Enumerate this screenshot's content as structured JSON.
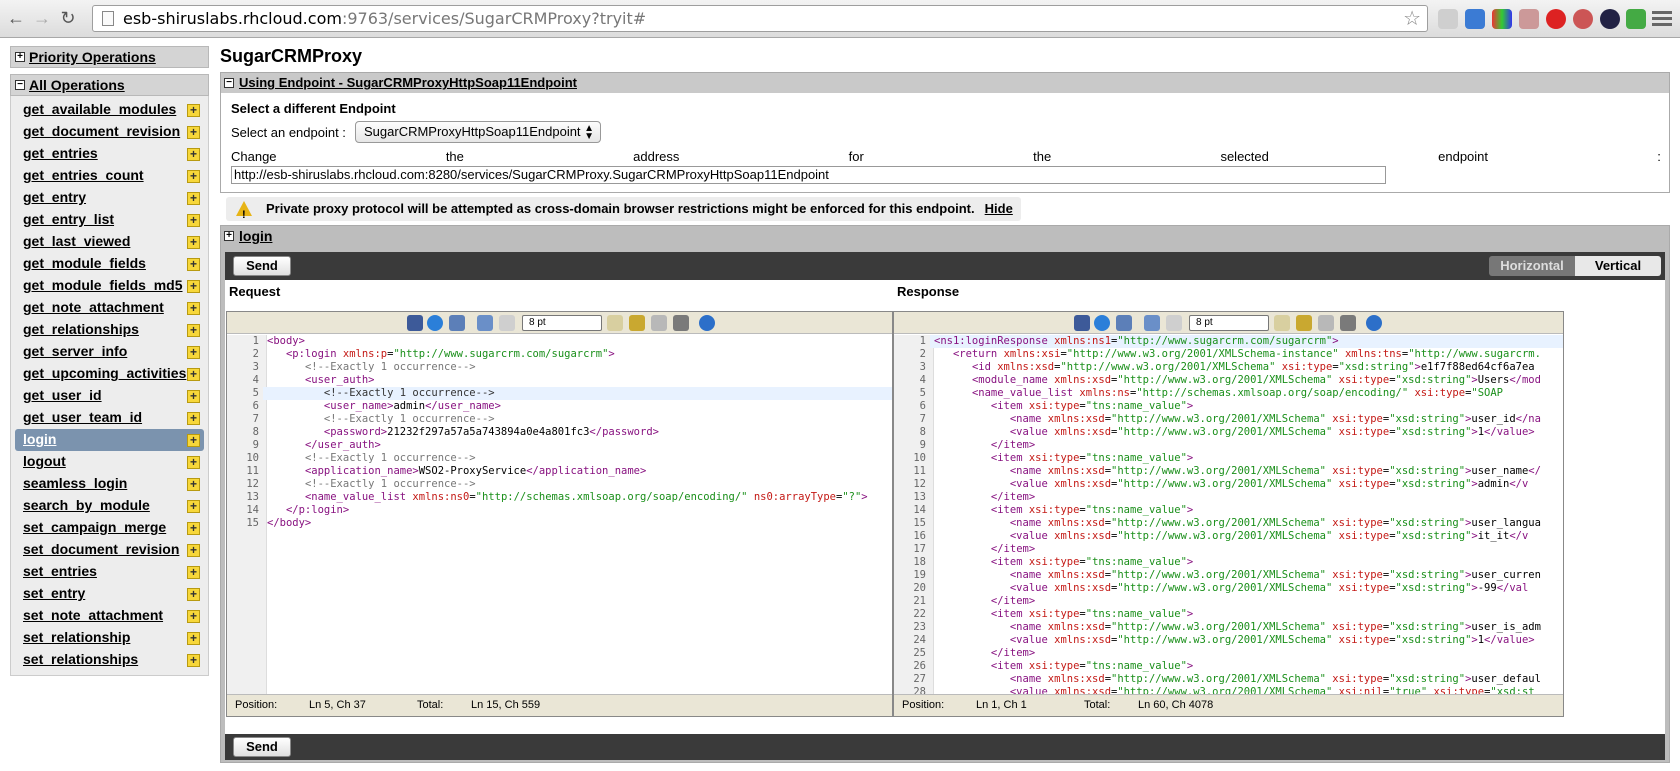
{
  "browser": {
    "url_host": "esb-shiruslabs.rhcloud.com",
    "url_path": ":9763/services/SugarCRMProxy?tryit#"
  },
  "sidebar": {
    "priority_label": "Priority Operations",
    "all_label": "All Operations",
    "operations": [
      "get_available_modules",
      "get_document_revision",
      "get_entries",
      "get_entries_count",
      "get_entry",
      "get_entry_list",
      "get_last_viewed",
      "get_module_fields",
      "get_module_fields_md5",
      "get_note_attachment",
      "get_relationships",
      "get_server_info",
      "get_upcoming_activities",
      "get_user_id",
      "get_user_team_id",
      "login",
      "logout",
      "seamless_login",
      "search_by_module",
      "set_campaign_merge",
      "set_document_revision",
      "set_entries",
      "set_entry",
      "set_note_attachment",
      "set_relationship",
      "set_relationships"
    ],
    "active": "login"
  },
  "main": {
    "title": "SugarCRMProxy",
    "endpoint_header": "Using Endpoint - SugarCRMProxyHttpSoap11Endpoint",
    "select_title": "Select a different Endpoint",
    "select_label": "Select an endpoint :",
    "selected_endpoint": "SugarCRMProxyHttpSoap11Endpoint",
    "change_words": [
      "Change",
      "the",
      "address",
      "for",
      "the",
      "selected",
      "endpoint",
      ":"
    ],
    "address": "http://esb-shiruslabs.rhcloud.com:8280/services/SugarCRMProxy.SugarCRMProxyHttpSoap11Endpoint",
    "warning": "Private proxy protocol will be attempted as cross-domain browser restrictions might be enforced for this endpoint.",
    "hide_label": "Hide"
  },
  "tryit": {
    "operation": "login",
    "send_label": "Send",
    "horizontal_label": "Horizontal",
    "vertical_label": "Vertical",
    "request_label": "Request",
    "response_label": "Response",
    "font_size": "8 pt",
    "request_status": {
      "position_label": "Position:",
      "position": "Ln 5, Ch 37",
      "total_label": "Total:",
      "total": "Ln 15, Ch 559"
    },
    "response_status": {
      "position_label": "Position:",
      "position": "Ln 1, Ch 1",
      "total_label": "Total:",
      "total": "Ln 60, Ch 4078"
    }
  }
}
